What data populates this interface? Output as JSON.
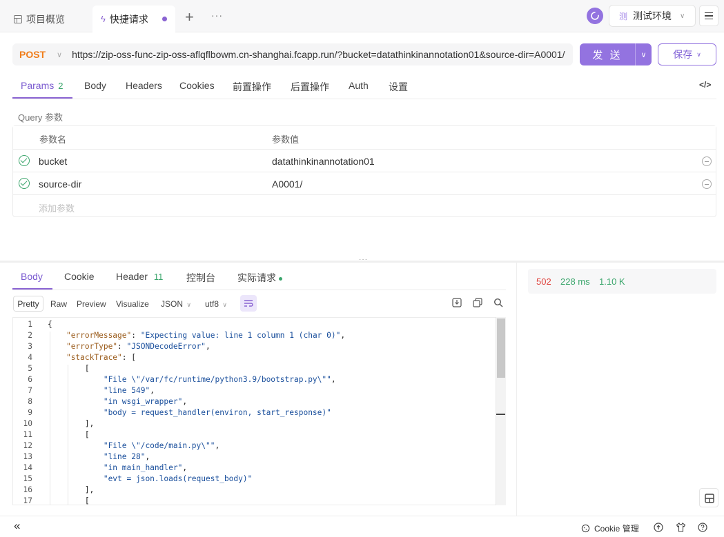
{
  "tabs": {
    "overview_label": "项目概览",
    "active_label": "快捷请求",
    "add_glyph": "+",
    "more_glyph": "···"
  },
  "env": {
    "label": "测试环境",
    "avatar_char": "测"
  },
  "request": {
    "method": "POST",
    "url": "https://zip-oss-func-zip-oss-aflqflbowm.cn-shanghai.fcapp.run/?bucket=datathinkinannotation01&source-dir=A0001/",
    "send_label": "发 送",
    "save_label": "保存"
  },
  "request_tabs": {
    "params": "Params",
    "params_count": "2",
    "body": "Body",
    "headers": "Headers",
    "cookies": "Cookies",
    "pre_ops": "前置操作",
    "post_ops": "后置操作",
    "auth": "Auth",
    "settings": "设置",
    "code_glyph": "</>"
  },
  "query": {
    "section_label": "Query 参数",
    "col_name": "参数名",
    "col_value": "参数值",
    "rows": [
      {
        "name": "bucket",
        "value": "datathinkinannotation01"
      },
      {
        "name": "source-dir",
        "value": "A0001/"
      }
    ],
    "add_placeholder": "添加参数"
  },
  "response_tabs": {
    "body": "Body",
    "cookie": "Cookie",
    "header": "Header",
    "header_count": "11",
    "console": "控制台",
    "actual": "实际请求"
  },
  "format_bar": {
    "pretty": "Pretty",
    "raw": "Raw",
    "preview": "Preview",
    "visualize": "Visualize",
    "type": "JSON",
    "encoding": "utf8"
  },
  "status": {
    "code": "502",
    "time": "228 ms",
    "size": "1.10 K"
  },
  "code_lines": [
    "{",
    "    \"errorMessage\": \"Expecting value: line 1 column 1 (char 0)\",",
    "    \"errorType\": \"JSONDecodeError\",",
    "    \"stackTrace\": [",
    "        [",
    "            \"File \\\"/var/fc/runtime/python3.9/bootstrap.py\\\"\",",
    "            \"line 549\",",
    "            \"in wsgi_wrapper\",",
    "            \"body = request_handler(environ, start_response)\"",
    "        ],",
    "        [",
    "            \"File \\\"/code/main.py\\\"\",",
    "            \"line 28\",",
    "            \"in main_handler\",",
    "            \"evt = json.loads(request_body)\"",
    "        ],",
    "        ["
  ],
  "footer": {
    "cookie_mgmt": "Cookie 管理",
    "collapse_glyph": "«"
  }
}
